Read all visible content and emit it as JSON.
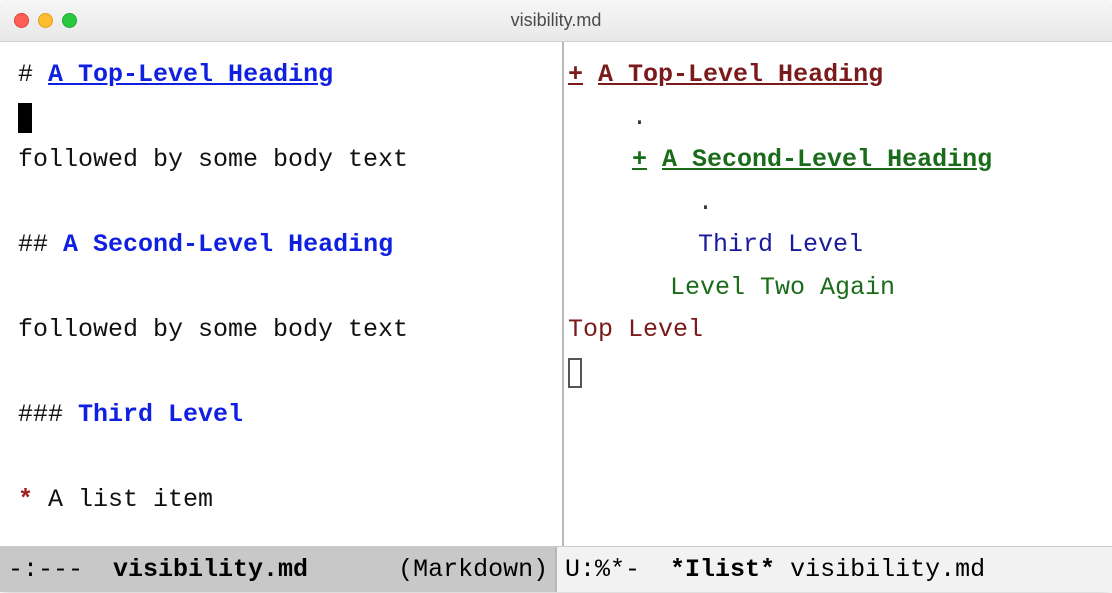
{
  "titlebar": {
    "title": "visibility.md"
  },
  "left_pane": {
    "lines": {
      "h1_hash": "#",
      "h1_text": "A Top-Level Heading",
      "body1": "followed by some body text",
      "h2_hash": "##",
      "h2_text": "A Second-Level Heading",
      "body2": "followed by some body text",
      "h3_hash": "###",
      "h3_text": "Third Level",
      "list_bullet": "*",
      "list_text": "A list item"
    }
  },
  "right_pane": {
    "lines": {
      "h1_prefix": "+",
      "h1_text": "A Top-Level Heading",
      "dot1": ".",
      "h2_prefix": "+",
      "h2_text": "A Second-Level Heading",
      "dot2": ".",
      "l3": "Third Level",
      "l2": "Level Two Again",
      "l1": "Top Level"
    }
  },
  "modeline": {
    "left_prefix": "-:---  ",
    "left_buffer": "visibility.md",
    "left_mode": "      (Markdown)",
    "right_prefix": "U:%*-  ",
    "right_buffer": "*Ilist*",
    "right_suffix": " visibility.md"
  }
}
